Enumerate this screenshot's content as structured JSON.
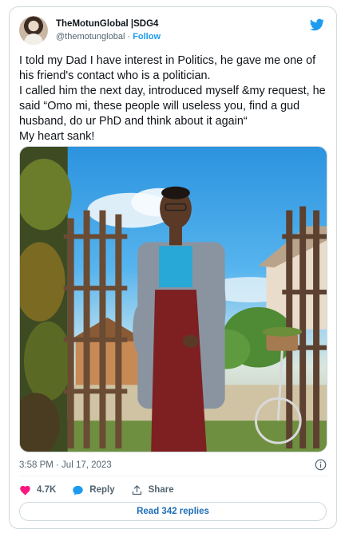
{
  "author": {
    "display_name": "TheMotunGlobal |SDG4",
    "handle": "@themotunglobal",
    "separator": "·",
    "follow_label": "Follow"
  },
  "tweet": {
    "text": "I told my Dad I have interest in Politics, he gave me one of his friend's contact who is a politician.\nI called him the next day, introduced myself &my request, he said “Omo mi, these people will useless you, find a gud husband, do ur PhD and think about it again“\nMy heart sank!",
    "timestamp": "3:58 PM · Jul 17, 2023"
  },
  "actions": {
    "likes_count": "4.7K",
    "reply_label": "Reply",
    "share_label": "Share",
    "read_replies_label": "Read 342 replies"
  },
  "icons": {
    "logo": "twitter-bird-icon",
    "like": "heart-icon",
    "reply": "speech-bubble-icon",
    "share": "share-upload-icon",
    "info": "info-icon"
  },
  "colors": {
    "brand": "#1d9bf0",
    "like": "#f91880",
    "text": "#0f1419",
    "secondary": "#536471"
  }
}
